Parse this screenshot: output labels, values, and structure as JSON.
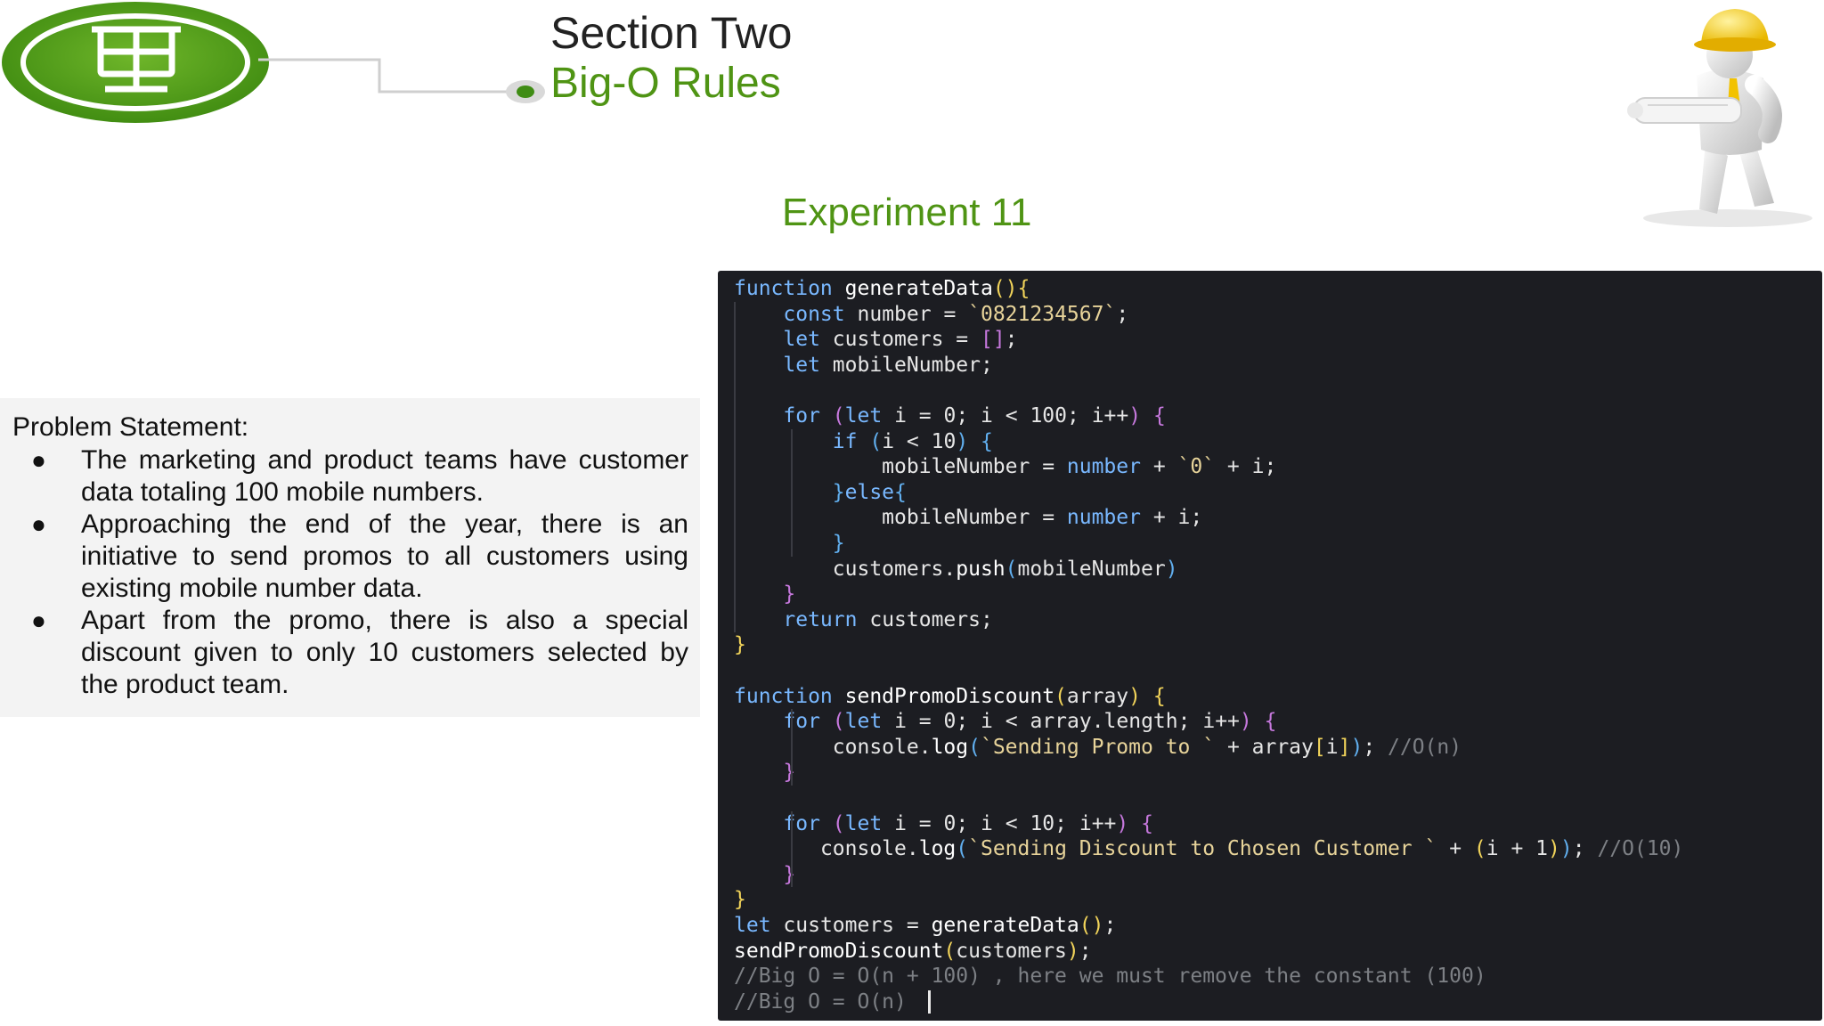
{
  "header": {
    "section_title": "Section Two",
    "section_subtitle": "Big-O Rules",
    "logo_icon": "presentation-board-icon",
    "mascot_icon": "construction-worker-figure"
  },
  "experiment_title": "Experiment 11",
  "problem": {
    "heading": "Problem Statement:",
    "bullet_glyph": "●",
    "items": [
      "The marketing and product teams have customer data totaling 100 mobile numbers.",
      "Approaching the end of the year, there is an initiative to send promos to all customers using existing mobile number data.",
      "Apart from the promo, there is also a special discount given to only 10 customers selected by the product team."
    ]
  },
  "code": {
    "lines": [
      [
        [
          "kw",
          "function"
        ],
        [
          "op",
          " "
        ],
        [
          "fn",
          "generateData"
        ],
        [
          "br1",
          "()"
        ],
        [
          "br1",
          "{"
        ]
      ],
      [
        [
          "op",
          "    "
        ],
        [
          "kw",
          "const"
        ],
        [
          "op",
          " "
        ],
        [
          "var",
          "number"
        ],
        [
          "op",
          " = "
        ],
        [
          "str",
          "`0821234567`"
        ],
        [
          "op",
          ";"
        ]
      ],
      [
        [
          "op",
          "    "
        ],
        [
          "kw",
          "let"
        ],
        [
          "op",
          " "
        ],
        [
          "var",
          "customers"
        ],
        [
          "op",
          " = "
        ],
        [
          "br2",
          "[]"
        ],
        [
          "op",
          ";"
        ]
      ],
      [
        [
          "op",
          "    "
        ],
        [
          "kw",
          "let"
        ],
        [
          "op",
          " "
        ],
        [
          "var",
          "mobileNumber"
        ],
        [
          "op",
          ";"
        ]
      ],
      [],
      [
        [
          "op",
          "    "
        ],
        [
          "kw",
          "for"
        ],
        [
          "op",
          " "
        ],
        [
          "br2",
          "("
        ],
        [
          "kw",
          "let"
        ],
        [
          "op",
          " "
        ],
        [
          "var",
          "i"
        ],
        [
          "op",
          " = "
        ],
        [
          "num",
          "0"
        ],
        [
          "op",
          "; "
        ],
        [
          "var",
          "i"
        ],
        [
          "op",
          " < "
        ],
        [
          "num",
          "100"
        ],
        [
          "op",
          "; "
        ],
        [
          "var",
          "i"
        ],
        [
          "op",
          "++"
        ],
        [
          "br2",
          ")"
        ],
        [
          "op",
          " "
        ],
        [
          "br2",
          "{"
        ]
      ],
      [
        [
          "op",
          "        "
        ],
        [
          "kw",
          "if"
        ],
        [
          "op",
          " "
        ],
        [
          "br3",
          "("
        ],
        [
          "var",
          "i"
        ],
        [
          "op",
          " < "
        ],
        [
          "num",
          "10"
        ],
        [
          "br3",
          ")"
        ],
        [
          "op",
          " "
        ],
        [
          "br3",
          "{"
        ]
      ],
      [
        [
          "op",
          "            "
        ],
        [
          "var",
          "mobileNumber"
        ],
        [
          "op",
          " = "
        ],
        [
          "kw",
          "number"
        ],
        [
          "op",
          " + "
        ],
        [
          "str",
          "`0`"
        ],
        [
          "op",
          " + "
        ],
        [
          "var",
          "i"
        ],
        [
          "op",
          ";"
        ]
      ],
      [
        [
          "op",
          "        "
        ],
        [
          "br3",
          "}"
        ],
        [
          "kw",
          "else"
        ],
        [
          "br3",
          "{"
        ]
      ],
      [
        [
          "op",
          "            "
        ],
        [
          "var",
          "mobileNumber"
        ],
        [
          "op",
          " = "
        ],
        [
          "kw",
          "number"
        ],
        [
          "op",
          " + "
        ],
        [
          "var",
          "i"
        ],
        [
          "op",
          ";"
        ]
      ],
      [
        [
          "op",
          "        "
        ],
        [
          "br3",
          "}"
        ]
      ],
      [
        [
          "op",
          "        "
        ],
        [
          "var",
          "customers"
        ],
        [
          "op",
          "."
        ],
        [
          "fn",
          "push"
        ],
        [
          "br3",
          "("
        ],
        [
          "var",
          "mobileNumber"
        ],
        [
          "br3",
          ")"
        ]
      ],
      [
        [
          "op",
          "    "
        ],
        [
          "br2",
          "}"
        ]
      ],
      [
        [
          "op",
          "    "
        ],
        [
          "kw",
          "return"
        ],
        [
          "op",
          " "
        ],
        [
          "var",
          "customers"
        ],
        [
          "op",
          ";"
        ]
      ],
      [
        [
          "br1",
          "}"
        ]
      ],
      [],
      [
        [
          "kw",
          "function"
        ],
        [
          "op",
          " "
        ],
        [
          "fn",
          "sendPromoDiscount"
        ],
        [
          "br1",
          "("
        ],
        [
          "var",
          "array"
        ],
        [
          "br1",
          ")"
        ],
        [
          "op",
          " "
        ],
        [
          "br1",
          "{"
        ]
      ],
      [
        [
          "op",
          "    "
        ],
        [
          "kw",
          "for"
        ],
        [
          "op",
          " "
        ],
        [
          "br2",
          "("
        ],
        [
          "kw",
          "let"
        ],
        [
          "op",
          " "
        ],
        [
          "var",
          "i"
        ],
        [
          "op",
          " = "
        ],
        [
          "num",
          "0"
        ],
        [
          "op",
          "; "
        ],
        [
          "var",
          "i"
        ],
        [
          "op",
          " < "
        ],
        [
          "var",
          "array"
        ],
        [
          "op",
          "."
        ],
        [
          "var",
          "length"
        ],
        [
          "op",
          "; "
        ],
        [
          "var",
          "i"
        ],
        [
          "op",
          "++"
        ],
        [
          "br2",
          ")"
        ],
        [
          "op",
          " "
        ],
        [
          "br2",
          "{"
        ]
      ],
      [
        [
          "op",
          "        "
        ],
        [
          "var",
          "console"
        ],
        [
          "op",
          "."
        ],
        [
          "fn",
          "log"
        ],
        [
          "br3",
          "("
        ],
        [
          "str",
          "`Sending Promo to `"
        ],
        [
          "op",
          " + "
        ],
        [
          "var",
          "array"
        ],
        [
          "br1",
          "["
        ],
        [
          "var",
          "i"
        ],
        [
          "br1",
          "]"
        ],
        [
          "br3",
          ")"
        ],
        [
          "op",
          "; "
        ],
        [
          "cmt",
          "//O(n)"
        ]
      ],
      [
        [
          "op",
          "    "
        ],
        [
          "br2",
          "}"
        ]
      ],
      [],
      [
        [
          "op",
          "    "
        ],
        [
          "kw",
          "for"
        ],
        [
          "op",
          " "
        ],
        [
          "br2",
          "("
        ],
        [
          "kw",
          "let"
        ],
        [
          "op",
          " "
        ],
        [
          "var",
          "i"
        ],
        [
          "op",
          " = "
        ],
        [
          "num",
          "0"
        ],
        [
          "op",
          "; "
        ],
        [
          "var",
          "i"
        ],
        [
          "op",
          " < "
        ],
        [
          "num",
          "10"
        ],
        [
          "op",
          "; "
        ],
        [
          "var",
          "i"
        ],
        [
          "op",
          "++"
        ],
        [
          "br2",
          ")"
        ],
        [
          "op",
          " "
        ],
        [
          "br2",
          "{"
        ]
      ],
      [
        [
          "op",
          "       "
        ],
        [
          "var",
          "console"
        ],
        [
          "op",
          "."
        ],
        [
          "fn",
          "log"
        ],
        [
          "br3",
          "("
        ],
        [
          "str",
          "`Sending Discount to Chosen Customer `"
        ],
        [
          "op",
          " + "
        ],
        [
          "br1",
          "("
        ],
        [
          "var",
          "i"
        ],
        [
          "op",
          " + "
        ],
        [
          "num",
          "1"
        ],
        [
          "br1",
          ")"
        ],
        [
          "br3",
          ")"
        ],
        [
          "op",
          "; "
        ],
        [
          "cmt",
          "//O(10)"
        ]
      ],
      [
        [
          "op",
          "    "
        ],
        [
          "br2",
          "}"
        ]
      ],
      [
        [
          "br1",
          "}"
        ]
      ],
      [
        [
          "kw",
          "let"
        ],
        [
          "op",
          " "
        ],
        [
          "var",
          "customers"
        ],
        [
          "op",
          " = "
        ],
        [
          "fn",
          "generateData"
        ],
        [
          "br1",
          "()"
        ],
        [
          "op",
          ";"
        ]
      ],
      [
        [
          "fn",
          "sendPromoDiscount"
        ],
        [
          "br1",
          "("
        ],
        [
          "var",
          "customers"
        ],
        [
          "br1",
          ")"
        ],
        [
          "op",
          ";"
        ]
      ],
      [
        [
          "cmt",
          "//Big O = O(n + 100) , here we must remove the constant (100)"
        ]
      ],
      [
        [
          "cmt",
          "//Big O = O(n)"
        ]
      ]
    ]
  }
}
